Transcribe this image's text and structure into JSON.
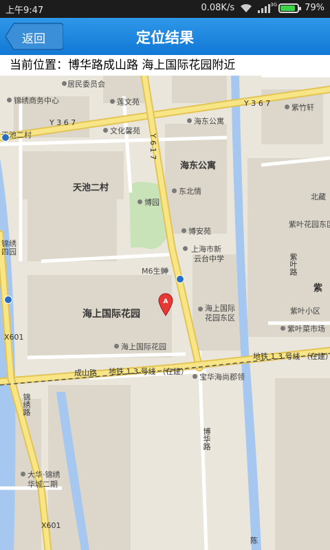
{
  "status_bar": {
    "time": "上午9:47",
    "speed": "0.08K/s",
    "network": "3G",
    "battery": "79%",
    "battery_level": 0.79
  },
  "titlebar": {
    "back_label": "返回",
    "title": "定位结果"
  },
  "location": {
    "text": "当前位置：博华路成山路 海上国际花园附近"
  },
  "map": {
    "marker_label": "A",
    "labels": {
      "juweihui": "居民委员会",
      "jinxiu_business": "锦绣商务中心",
      "lianwenyuan": "莲文苑",
      "y367_left": "Y 3 6 7",
      "y367_right": "Y 3 6 7",
      "haidong_gongyu_small": "海东公寓",
      "zhuzhuxuan": "紫竹轩",
      "tianchi_erqu_small": "天池二村",
      "wenhua_shuyuan": "文化馨苑",
      "y617": "Y 6 1 7",
      "haidong_gongyu": "海东公寓",
      "tianchi_ercun": "天池二村",
      "dongbeiqing": "东北情",
      "beijing": "北藏",
      "boyuan": "博园",
      "zhuye_huayuan_dongqu": "紫叶花园东区",
      "boanyuan": "博安苑",
      "shanghai_xinyuntai": "上海市新",
      "yuntai_zhongxue": "云台中学",
      "jinxiu_huayuan": "锦绣",
      "sidi_yuan": "四园",
      "m6_shengxian": "M6生鲜",
      "zhuye_road": "紫叶路",
      "zi": "紫",
      "haishang_guoji_huayuan": "海上国际花园",
      "haishang_dongqu_1": "海上国际",
      "haishang_dongqu_2": "花园东区",
      "zhuye_xiaoqu": "紫叶小区",
      "zhuye_market": "紫叶菜市场",
      "x601_top": "X601",
      "haishang_guoji_huayuan_small": "海上国际花园",
      "metro_line_right": "地铁 1 3 号线 （在建）",
      "chengshan_road": "成山路",
      "metro_line_left": "地铁 1 3 号线 （在建）",
      "baohua_haishang": "宝华海尚郡领",
      "jinxiu_road": "锦绣路",
      "bohua_road": "博华路",
      "dahua_jinxiu_1": "大华·锦绣",
      "dahua_jinxiu_2": "华城二期",
      "x601_bottom": "X601",
      "chen": "陈"
    }
  },
  "colors": {
    "titlebar": "#1c86e0",
    "road_major": "#f8e586",
    "road_major_border": "#e2c456",
    "water": "#a6c8f0",
    "park": "#c7e3b7",
    "pin": "#e53935"
  }
}
